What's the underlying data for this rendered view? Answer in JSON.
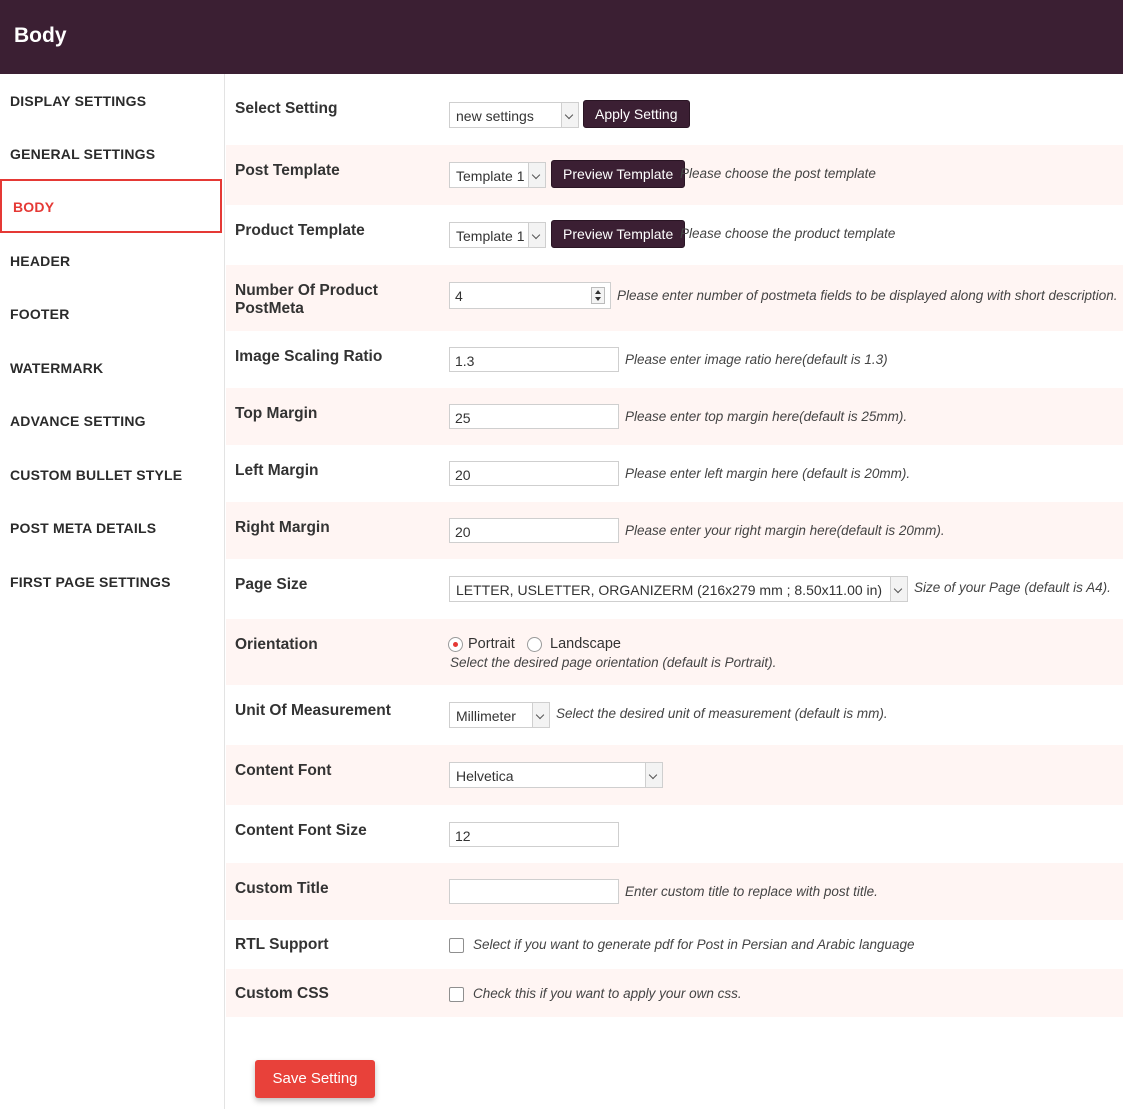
{
  "header": {
    "title": "Body"
  },
  "sidebar": {
    "items": [
      {
        "label": "DISPLAY SETTINGS"
      },
      {
        "label": "GENERAL SETTINGS"
      },
      {
        "label": "BODY"
      },
      {
        "label": "HEADER"
      },
      {
        "label": "FOOTER"
      },
      {
        "label": "WATERMARK"
      },
      {
        "label": "ADVANCE SETTING"
      },
      {
        "label": "CUSTOM BULLET STYLE"
      },
      {
        "label": "POST META DETAILS"
      },
      {
        "label": "FIRST PAGE SETTINGS"
      }
    ],
    "active": "BODY"
  },
  "form": {
    "select_setting": {
      "label": "Select Setting",
      "value": "new settings",
      "button": "Apply Setting"
    },
    "post_template": {
      "label": "Post Template",
      "value": "Template 1",
      "button": "Preview Template",
      "help": "Please choose the post template"
    },
    "product_template": {
      "label": "Product Template",
      "value": "Template 1",
      "button": "Preview Template",
      "help": "Please choose the product template"
    },
    "num_postmeta": {
      "label_line1": "Number Of Product",
      "label_line2": "PostMeta",
      "value": "4",
      "help": "Please enter number of postmeta fields to be displayed along with short description."
    },
    "image_scaling": {
      "label": "Image Scaling Ratio",
      "value": "1.3",
      "help": "Please enter image ratio here(default is 1.3)"
    },
    "top_margin": {
      "label": "Top Margin",
      "value": "25",
      "help": "Please enter top margin here(default is 25mm)."
    },
    "left_margin": {
      "label": "Left Margin",
      "value": "20",
      "help": "Please enter left margin here (default is 20mm)."
    },
    "right_margin": {
      "label": "Right Margin",
      "value": "20",
      "help": "Please enter your right margin here(default is 20mm)."
    },
    "page_size": {
      "label": "Page Size",
      "value": "LETTER, USLETTER, ORGANIZERM (216x279 mm ; 8.50x11.00 in)",
      "help": "Size of your Page (default is A4)."
    },
    "orientation": {
      "label": "Orientation",
      "option1": "Portrait",
      "option2": "Landscape",
      "selected": "Portrait",
      "help": "Select the desired page orientation (default is Portrait)."
    },
    "unit": {
      "label": "Unit Of Measurement",
      "value": "Millimeter",
      "help": "Select the desired unit of measurement (default is mm)."
    },
    "content_font": {
      "label": "Content Font",
      "value": "Helvetica"
    },
    "content_font_size": {
      "label": "Content Font Size",
      "value": "12"
    },
    "custom_title": {
      "label": "Custom Title",
      "value": "",
      "help": "Enter custom title to replace with post title."
    },
    "rtl_support": {
      "label": "RTL Support",
      "checked": false,
      "help": "Select if you want to generate pdf for Post in Persian and Arabic language"
    },
    "custom_css": {
      "label": "Custom CSS",
      "checked": false,
      "help": "Check this if you want to apply your own css."
    }
  },
  "save_button": "Save Setting",
  "colors": {
    "header_bg": "#3b1f33",
    "accent": "#e53935",
    "row_alt": "#fff5f3",
    "save_bg": "#e8413a"
  }
}
